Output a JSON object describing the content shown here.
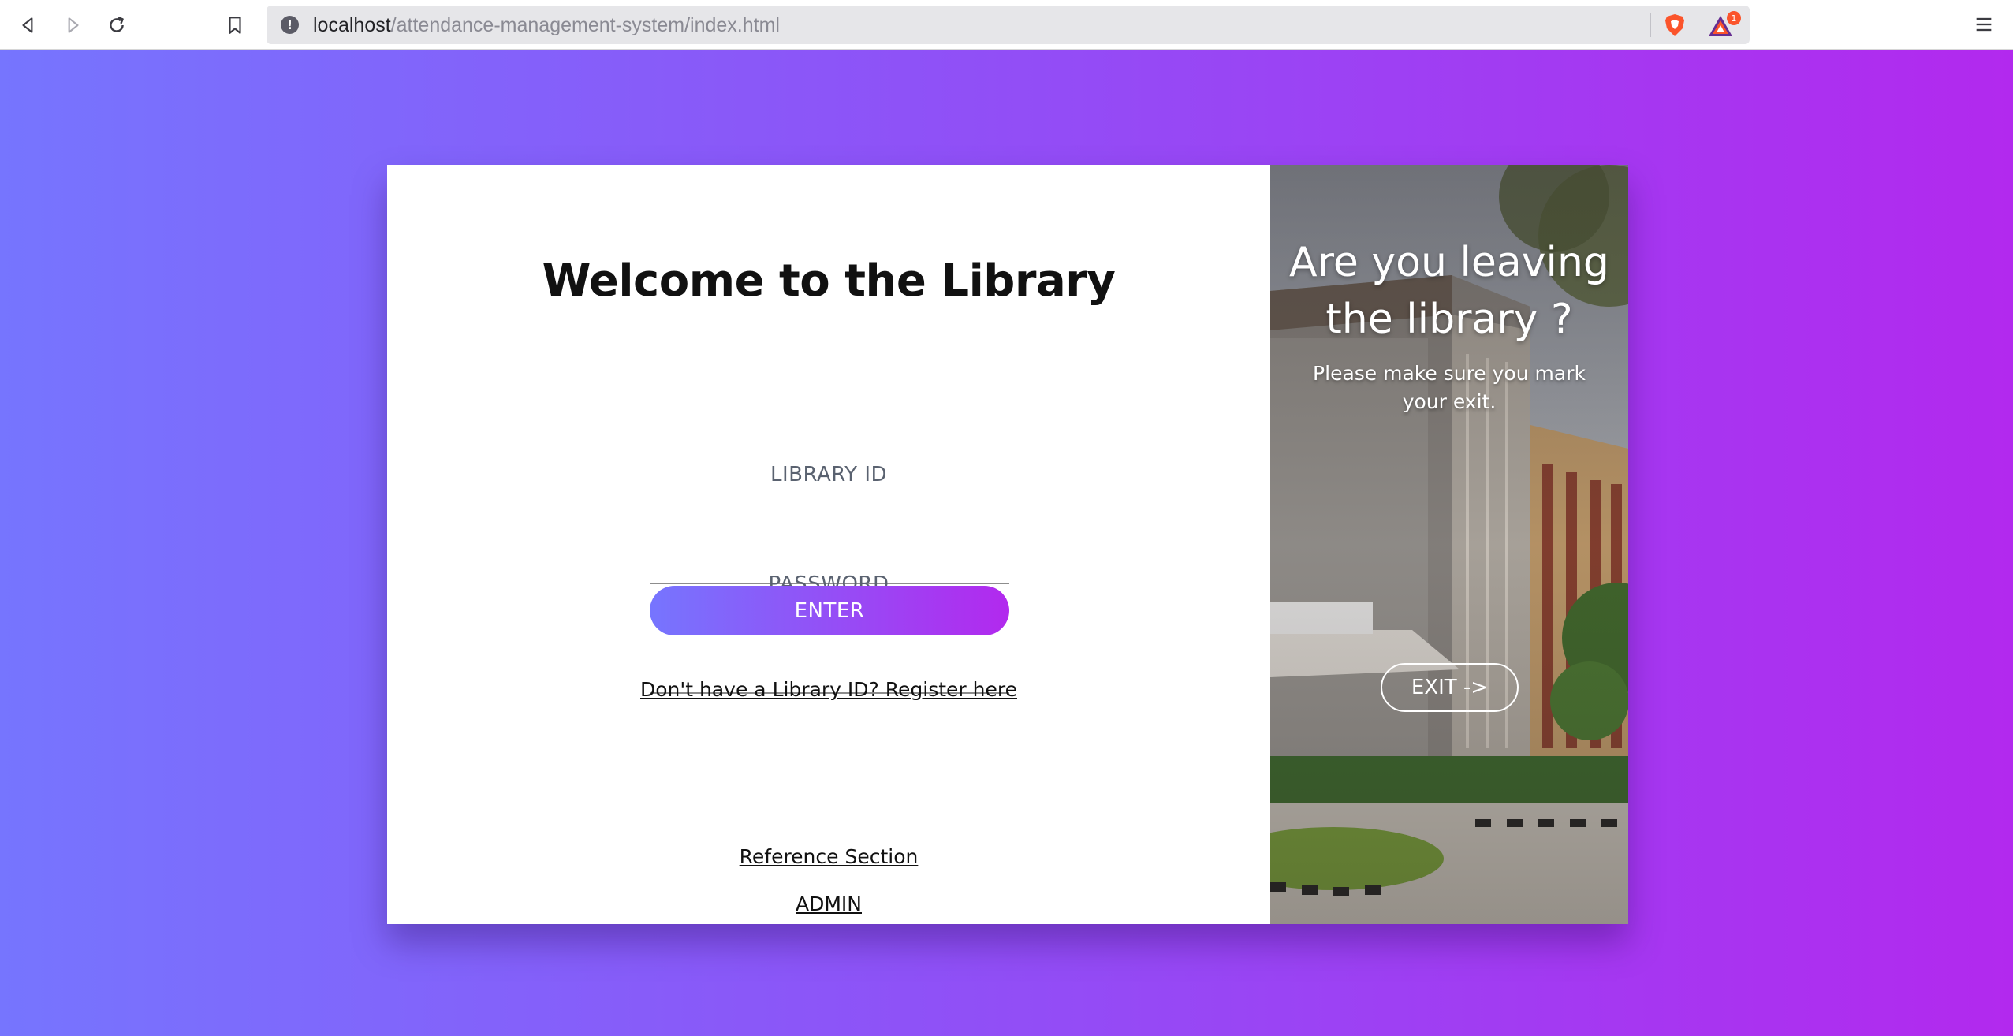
{
  "browser": {
    "url_host": "localhost",
    "url_path": "/attendance-management-system/index.html",
    "rewards_badge": "1"
  },
  "login": {
    "title": "Welcome to the Library",
    "library_id_label": "LIBRARY ID",
    "library_id_value": "",
    "password_label": "PASSWORD",
    "password_value": "",
    "enter_label": "ENTER",
    "register_link": "Don't have a Library ID? Register here",
    "reference_link": "Reference Section",
    "admin_link": "ADMIN"
  },
  "exit_panel": {
    "title": "Are you leaving the library ?",
    "text": "Please make sure you mark your exit.",
    "exit_label": "EXIT ->"
  },
  "colors": {
    "gradient_start": "#7675fe",
    "gradient_end": "#b229ee"
  },
  "icons": [
    "back-icon",
    "forward-icon",
    "reload-icon",
    "bookmark-icon",
    "site-info-icon",
    "brave-shields-icon",
    "brave-rewards-icon",
    "menu-icon"
  ]
}
